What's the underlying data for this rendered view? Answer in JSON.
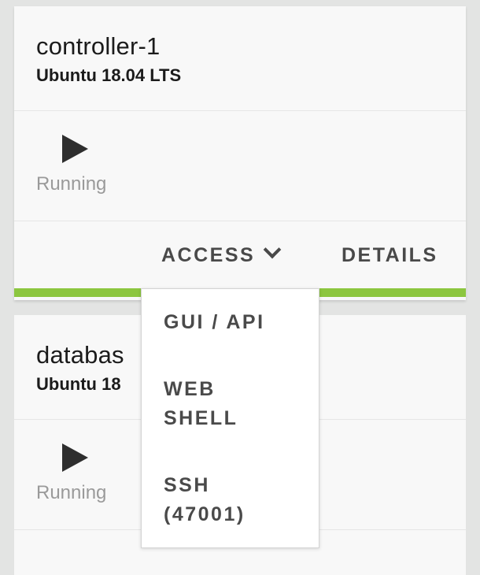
{
  "instances": [
    {
      "name": "controller-1",
      "os": "Ubuntu 18.04 LTS",
      "status": "Running",
      "actions": {
        "access_label": "ACCESS",
        "details_label": "DETAILS"
      }
    },
    {
      "name": "databas",
      "os": "Ubuntu 18",
      "status": "Running"
    }
  ],
  "access_menu": {
    "items": [
      {
        "line1": "GUI / API"
      },
      {
        "line1": "WEB",
        "line2": "SHELL"
      },
      {
        "line1": "SSH",
        "line2": "(47001)"
      }
    ]
  },
  "colors": {
    "accent": "#8cc63f",
    "card_bg": "#f8f8f8",
    "page_bg": "#e3e4e3",
    "status_text": "#9a9a9a"
  },
  "icons": {
    "status": "play-icon",
    "dropdown": "chevron-down-icon"
  }
}
